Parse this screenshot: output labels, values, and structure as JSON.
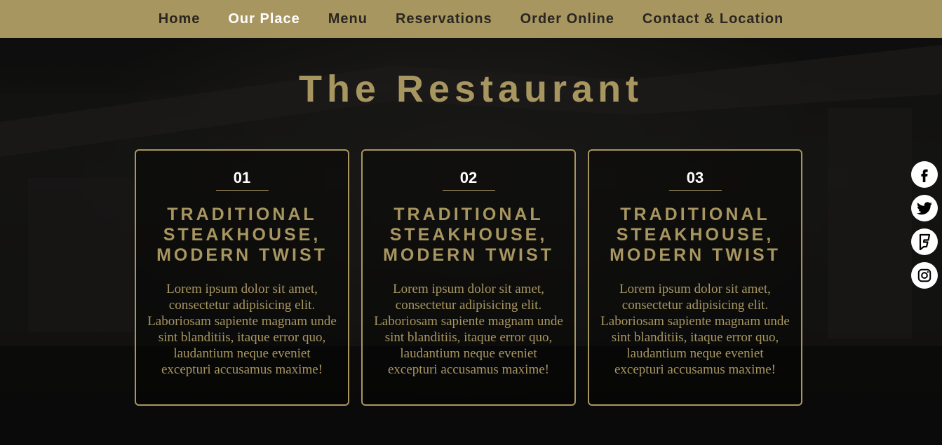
{
  "nav": {
    "items": [
      {
        "label": "Home",
        "active": false
      },
      {
        "label": "Our Place",
        "active": true
      },
      {
        "label": "Menu",
        "active": false
      },
      {
        "label": "Reservations",
        "active": false
      },
      {
        "label": "Order Online",
        "active": false
      },
      {
        "label": "Contact & Location",
        "active": false
      }
    ]
  },
  "section": {
    "title": "The Restaurant"
  },
  "cards": [
    {
      "number": "01",
      "heading": "TRADITIONAL STEAKHOUSE, MODERN TWIST",
      "text": "Lorem ipsum dolor sit amet, consectetur adipisicing elit. Laboriosam sapiente magnam unde sint blanditiis, itaque error quo, laudantium neque eveniet excepturi accusamus maxime!"
    },
    {
      "number": "02",
      "heading": "TRADITIONAL STEAKHOUSE, MODERN TWIST",
      "text": "Lorem ipsum dolor sit amet, consectetur adipisicing elit. Laboriosam sapiente magnam unde sint blanditiis, itaque error quo, laudantium neque eveniet excepturi accusamus maxime!"
    },
    {
      "number": "03",
      "heading": "TRADITIONAL STEAKHOUSE, MODERN TWIST",
      "text": "Lorem ipsum dolor sit amet, consectetur adipisicing elit. Laboriosam sapiente magnam unde sint blanditiis, itaque error quo, laudantium neque eveniet excepturi accusamus maxime!"
    }
  ],
  "social": {
    "icons": [
      "facebook-icon",
      "twitter-icon",
      "foursquare-icon",
      "instagram-icon"
    ]
  },
  "colors": {
    "accent": "#a89660",
    "nav_text": "#2a2620",
    "active_text": "#ffffff",
    "background": "#0a0a0a"
  }
}
